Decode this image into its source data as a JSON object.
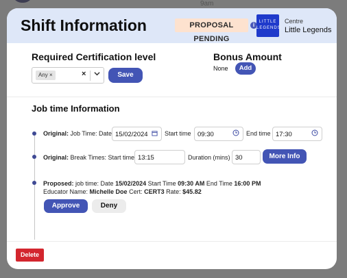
{
  "background": {
    "time": "9am"
  },
  "modal": {
    "title": "Shift Information",
    "status_badge": "PROPOSAL PENDING",
    "logo_text": "LITTLE LEGENDS",
    "centre_label": "Centre",
    "centre_name": "Little Legends"
  },
  "certification": {
    "heading": "Required Certification level",
    "selected_chip": "Any",
    "chip_remove": "×",
    "clear_icon": "×",
    "save_label": "Save"
  },
  "bonus": {
    "heading": "Bonus Amount",
    "value": "None",
    "add_label": "Add"
  },
  "job_time": {
    "heading": "Job time Information",
    "original_job": {
      "prefix": "Original:",
      "label": "Job Time: Date",
      "date": "15/02/2024",
      "start_label": "Start time",
      "start": "09:30",
      "end_label": "End time",
      "end": "17:30"
    },
    "original_break": {
      "prefix": "Original:",
      "label": "Break Times: Start time",
      "start": "13:15",
      "duration_label": "Duration (mins)",
      "duration": "30",
      "more_info_label": "More Info"
    },
    "proposed": {
      "prefix": "Proposed:",
      "t1": "job time: Date",
      "date": "15/02/2024",
      "t2": "Start Time",
      "start": "09:30 AM",
      "t3": "End Time",
      "end": "16:00 PM",
      "t4": "Educator Name:",
      "educator": "Michelle Doe",
      "t5": "Cert:",
      "cert": "CERT3",
      "t6": "Rate:",
      "rate": "$45.82"
    },
    "approve_label": "Approve",
    "deny_label": "Deny"
  },
  "footer": {
    "delete_label": "Delete"
  },
  "colors": {
    "primary": "#4355b5",
    "header_bg": "#dee7f8",
    "badge_bg": "#fde2cf",
    "danger": "#d3262e"
  }
}
